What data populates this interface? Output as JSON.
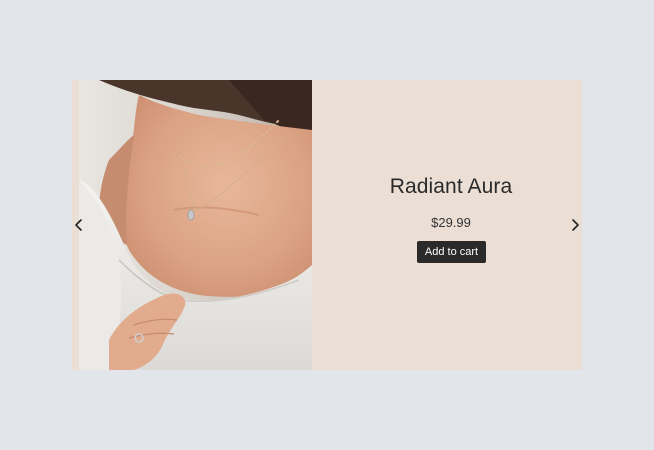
{
  "product": {
    "name": "Radiant Aura",
    "price": "$29.99",
    "add_to_cart_label": "Add to cart"
  },
  "carousel": {
    "prev_icon": "chevron-left-icon",
    "next_icon": "chevron-right-icon"
  },
  "colors": {
    "page_background": "#e2e6eb",
    "card_background": "#eaded5",
    "button_background": "#2a2a2a",
    "button_text": "#ffffff",
    "title_text": "#2a2a2a"
  }
}
